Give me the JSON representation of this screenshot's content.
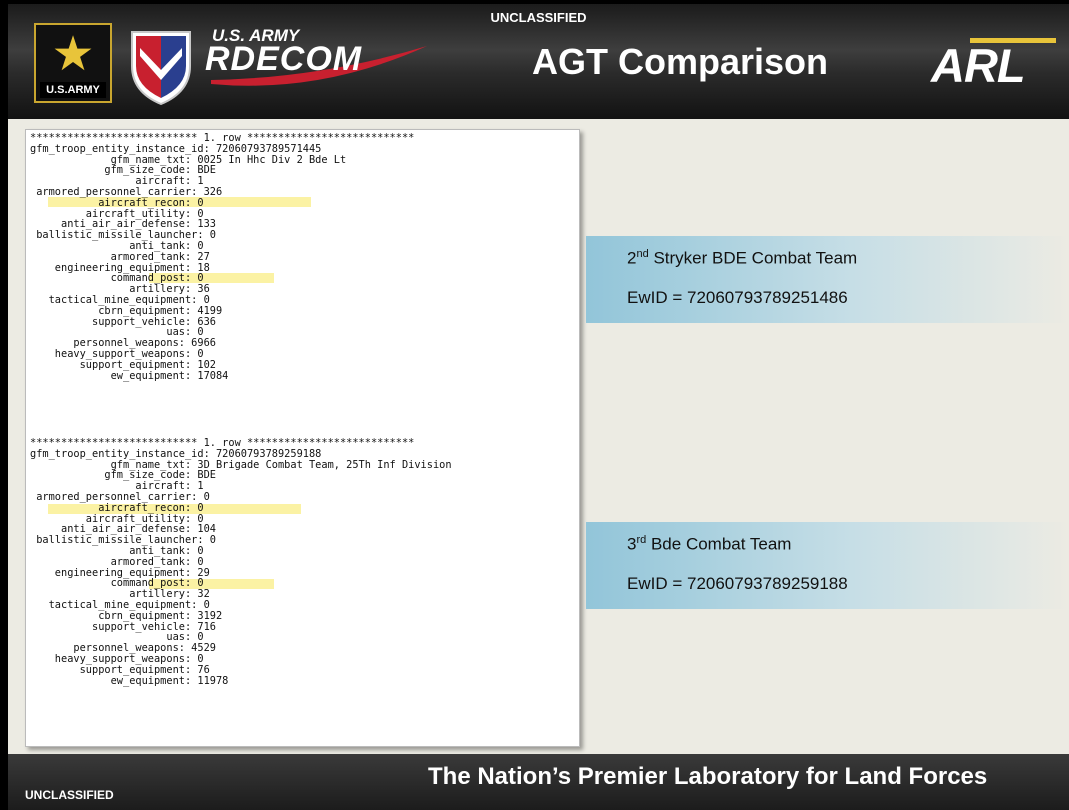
{
  "header": {
    "classification": "UNCLASSIFIED",
    "title": "AGT Comparison",
    "army_logo_text": "U.S.ARMY",
    "rdecom_small": "U.S. ARMY",
    "rdecom": "RDECOM",
    "arl": "ARL"
  },
  "record1": {
    "text": "*************************** 1. row ***************************\ngfm_troop_entity_instance_id: 72060793789571445\n             gfm_name_txt: 0025 In Hhc Div 2 Bde Lt\n            gfm_size_code: BDE\n                 aircraft: 1\n armored_personnel_carrier: 326\n           aircraft_recon: 0\n         aircraft_utility: 0\n     anti_air_air_defense: 133\n ballistic_missile_launcher: 0\n                anti_tank: 0\n             armored_tank: 27\n    engineering_equipment: 18\n             command_post: 0\n                artillery: 36\n   tactical_mine_equipment: 0\n           cbrn_equipment: 4199\n          support_vehicle: 636\n                      uas: 0\n       personnel_weapons: 6966\n    heavy_support_weapons: 0\n        support_equipment: 102\n             ew_equipment: 17084"
  },
  "record2": {
    "text": "*************************** 1. row ***************************\ngfm_troop_entity_instance_id: 72060793789259188\n             gfm_name_txt: 3D Brigade Combat Team, 25Th Inf Division\n            gfm_size_code: BDE\n                 aircraft: 1\n armored_personnel_carrier: 0\n           aircraft_recon: 0\n         aircraft_utility: 0\n     anti_air_air_defense: 104\n ballistic_missile_launcher: 0\n                anti_tank: 0\n             armored_tank: 0\n    engineering_equipment: 29\n             command_post: 0\n                artillery: 32\n   tactical_mine_equipment: 0\n           cbrn_equipment: 3192\n          support_vehicle: 716\n                      uas: 0\n       personnel_weapons: 4529\n    heavy_support_weapons: 0\n        support_equipment: 76\n             ew_equipment: 11978"
  },
  "team1": {
    "num": "2",
    "sup": "nd",
    "rest": " Stryker BDE Combat Team",
    "ewid": "EwID = 72060793789251486"
  },
  "team2": {
    "num": "3",
    "sup": "rd",
    "rest": " Bde Combat Team",
    "ewid": "EwID = 72060793789259188"
  },
  "footer": {
    "classification": "UNCLASSIFIED",
    "tagline": "The Nation’s Premier Laboratory for Land Forces"
  },
  "colors": {
    "highlight": "#fbf2a4",
    "team_box": "#92c5d9",
    "banner": "#2b2b2b"
  }
}
